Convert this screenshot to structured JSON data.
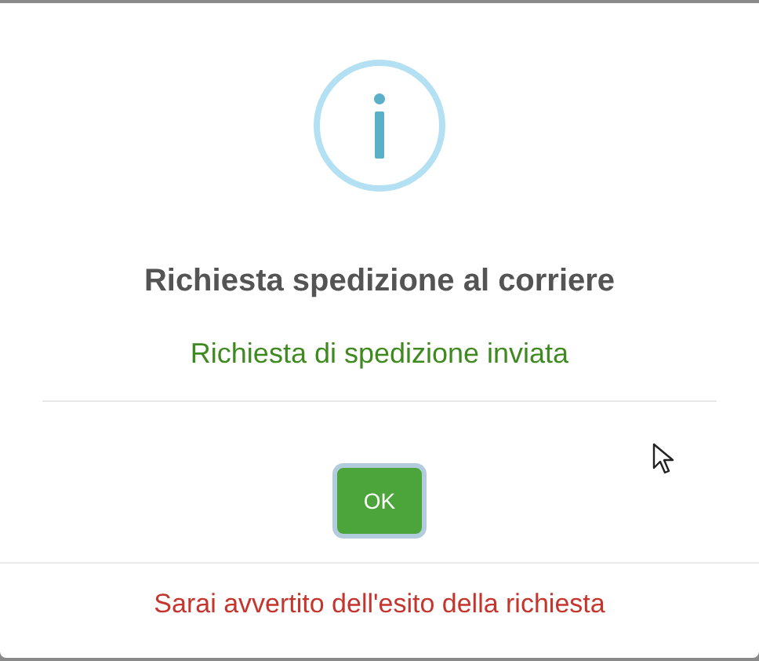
{
  "dialog": {
    "icon": {
      "kind": "info"
    },
    "title": "Richiesta spedizione al corriere",
    "message": "Richiesta di spedizione inviata",
    "confirm_button": {
      "label": "OK",
      "focused": true
    },
    "footer": "Sarai avvertito dell'esito della richiesta"
  }
}
